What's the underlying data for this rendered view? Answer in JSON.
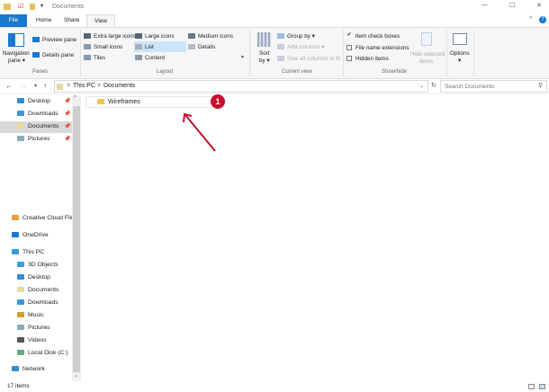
{
  "window": {
    "title": "Documents",
    "controls": [
      "—",
      "☐",
      "✕"
    ]
  },
  "tabs": [
    {
      "label": "File"
    },
    {
      "label": "Home"
    },
    {
      "label": "Share"
    },
    {
      "label": "View",
      "active": true
    }
  ],
  "ribbon": {
    "panes": {
      "navigation_pane": "Navigation",
      "navigation_pane2": "pane ▾",
      "preview_pane": "Preview pane",
      "details_pane": "Details pane",
      "group": "Panes"
    },
    "layout": {
      "items": [
        "Extra large icons",
        "Large icons",
        "Medium icons",
        "Small icons",
        "List",
        "Details",
        "Tiles",
        "Content"
      ],
      "selected": "List",
      "group": "Layout"
    },
    "current_view": {
      "sort": "Sort",
      "sort2": "by ▾",
      "group_by": "Group by ▾",
      "add_columns": "Add columns ▾",
      "size_columns": "Size all columns to fit",
      "group": "Current view"
    },
    "show_hide": {
      "item_check_boxes": "Item check boxes",
      "item_check_boxes_checked": true,
      "file_name_extensions": "File name extensions",
      "hidden_items": "Hidden items",
      "hide_selected": "Hide selected",
      "hide_selected2": "items",
      "group": "Show/hide"
    },
    "options": {
      "label": "Options",
      "arrow": "▾"
    }
  },
  "address": {
    "crumbs": [
      "This PC",
      "Documents"
    ],
    "separator": ">",
    "search_placeholder": "Search Documents"
  },
  "nav": {
    "quick": [
      {
        "label": "Desktop"
      },
      {
        "label": "Downloads"
      },
      {
        "label": "Documents",
        "selected": true
      },
      {
        "label": "Pictures"
      }
    ],
    "other": [
      {
        "label": "Creative Cloud Files"
      },
      {
        "label": "OneDrive"
      },
      {
        "label": "This PC"
      }
    ],
    "thispc": [
      {
        "label": "3D Objects"
      },
      {
        "label": "Desktop"
      },
      {
        "label": "Documents"
      },
      {
        "label": "Downloads"
      },
      {
        "label": "Music"
      },
      {
        "label": "Pictures"
      },
      {
        "label": "Videos"
      },
      {
        "label": "Local Disk (C:)"
      }
    ],
    "network": "Network"
  },
  "files": [
    {
      "name": "Wireframes"
    }
  ],
  "annotation": {
    "badge": "1",
    "color": "#c8102e"
  },
  "status": {
    "count": "17 items"
  },
  "colors": {
    "accent": "#1979ca",
    "folder": "#f2c34f"
  }
}
